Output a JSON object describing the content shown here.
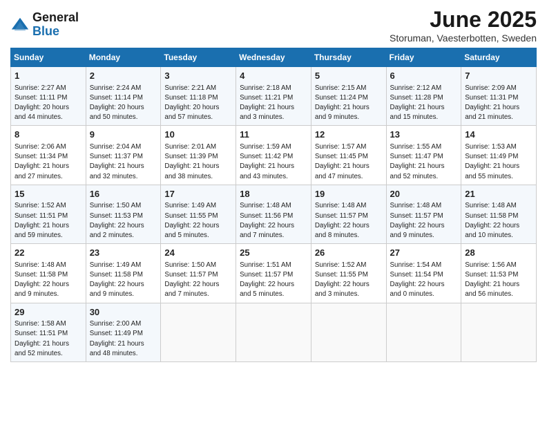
{
  "logo": {
    "general": "General",
    "blue": "Blue"
  },
  "title": "June 2025",
  "location": "Storuman, Vaesterbotten, Sweden",
  "headers": [
    "Sunday",
    "Monday",
    "Tuesday",
    "Wednesday",
    "Thursday",
    "Friday",
    "Saturday"
  ],
  "weeks": [
    [
      {
        "day": "1",
        "sunrise": "2:27 AM",
        "sunset": "11:11 PM",
        "daylight": "20 hours and 44 minutes."
      },
      {
        "day": "2",
        "sunrise": "2:24 AM",
        "sunset": "11:14 PM",
        "daylight": "20 hours and 50 minutes."
      },
      {
        "day": "3",
        "sunrise": "2:21 AM",
        "sunset": "11:18 PM",
        "daylight": "20 hours and 57 minutes."
      },
      {
        "day": "4",
        "sunrise": "2:18 AM",
        "sunset": "11:21 PM",
        "daylight": "21 hours and 3 minutes."
      },
      {
        "day": "5",
        "sunrise": "2:15 AM",
        "sunset": "11:24 PM",
        "daylight": "21 hours and 9 minutes."
      },
      {
        "day": "6",
        "sunrise": "2:12 AM",
        "sunset": "11:28 PM",
        "daylight": "21 hours and 15 minutes."
      },
      {
        "day": "7",
        "sunrise": "2:09 AM",
        "sunset": "11:31 PM",
        "daylight": "21 hours and 21 minutes."
      }
    ],
    [
      {
        "day": "8",
        "sunrise": "2:06 AM",
        "sunset": "11:34 PM",
        "daylight": "21 hours and 27 minutes."
      },
      {
        "day": "9",
        "sunrise": "2:04 AM",
        "sunset": "11:37 PM",
        "daylight": "21 hours and 32 minutes."
      },
      {
        "day": "10",
        "sunrise": "2:01 AM",
        "sunset": "11:39 PM",
        "daylight": "21 hours and 38 minutes."
      },
      {
        "day": "11",
        "sunrise": "1:59 AM",
        "sunset": "11:42 PM",
        "daylight": "21 hours and 43 minutes."
      },
      {
        "day": "12",
        "sunrise": "1:57 AM",
        "sunset": "11:45 PM",
        "daylight": "21 hours and 47 minutes."
      },
      {
        "day": "13",
        "sunrise": "1:55 AM",
        "sunset": "11:47 PM",
        "daylight": "21 hours and 52 minutes."
      },
      {
        "day": "14",
        "sunrise": "1:53 AM",
        "sunset": "11:49 PM",
        "daylight": "21 hours and 55 minutes."
      }
    ],
    [
      {
        "day": "15",
        "sunrise": "1:52 AM",
        "sunset": "11:51 PM",
        "daylight": "21 hours and 59 minutes."
      },
      {
        "day": "16",
        "sunrise": "1:50 AM",
        "sunset": "11:53 PM",
        "daylight": "22 hours and 2 minutes."
      },
      {
        "day": "17",
        "sunrise": "1:49 AM",
        "sunset": "11:55 PM",
        "daylight": "22 hours and 5 minutes."
      },
      {
        "day": "18",
        "sunrise": "1:48 AM",
        "sunset": "11:56 PM",
        "daylight": "22 hours and 7 minutes."
      },
      {
        "day": "19",
        "sunrise": "1:48 AM",
        "sunset": "11:57 PM",
        "daylight": "22 hours and 8 minutes."
      },
      {
        "day": "20",
        "sunrise": "1:48 AM",
        "sunset": "11:57 PM",
        "daylight": "22 hours and 9 minutes."
      },
      {
        "day": "21",
        "sunrise": "1:48 AM",
        "sunset": "11:58 PM",
        "daylight": "22 hours and 10 minutes."
      }
    ],
    [
      {
        "day": "22",
        "sunrise": "1:48 AM",
        "sunset": "11:58 PM",
        "daylight": "22 hours and 9 minutes."
      },
      {
        "day": "23",
        "sunrise": "1:49 AM",
        "sunset": "11:58 PM",
        "daylight": "22 hours and 9 minutes."
      },
      {
        "day": "24",
        "sunrise": "1:50 AM",
        "sunset": "11:57 PM",
        "daylight": "22 hours and 7 minutes."
      },
      {
        "day": "25",
        "sunrise": "1:51 AM",
        "sunset": "11:57 PM",
        "daylight": "22 hours and 5 minutes."
      },
      {
        "day": "26",
        "sunrise": "1:52 AM",
        "sunset": "11:55 PM",
        "daylight": "22 hours and 3 minutes."
      },
      {
        "day": "27",
        "sunrise": "1:54 AM",
        "sunset": "11:54 PM",
        "daylight": "22 hours and 0 minutes."
      },
      {
        "day": "28",
        "sunrise": "1:56 AM",
        "sunset": "11:53 PM",
        "daylight": "21 hours and 56 minutes."
      }
    ],
    [
      {
        "day": "29",
        "sunrise": "1:58 AM",
        "sunset": "11:51 PM",
        "daylight": "21 hours and 52 minutes."
      },
      {
        "day": "30",
        "sunrise": "2:00 AM",
        "sunset": "11:49 PM",
        "daylight": "21 hours and 48 minutes."
      },
      null,
      null,
      null,
      null,
      null
    ]
  ]
}
